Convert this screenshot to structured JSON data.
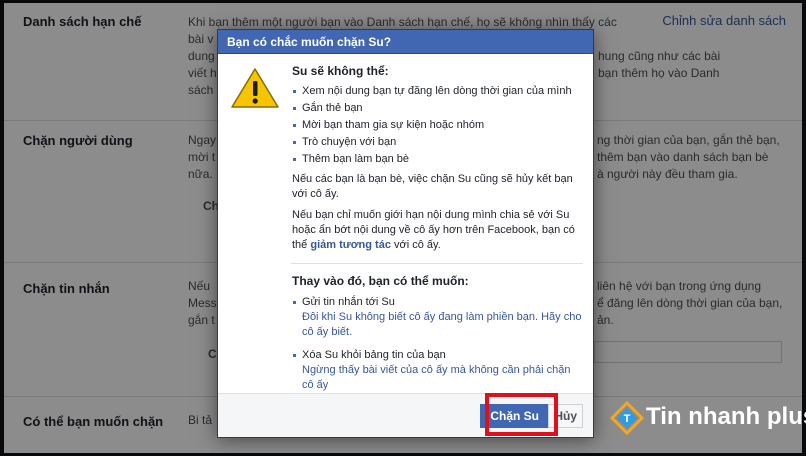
{
  "background": {
    "sections": [
      {
        "title": "Danh sách hạn chế",
        "action": "Chỉnh sửa danh sách",
        "lines": [
          "Khi bạn thêm một người bạn vào Danh sách hạn chế, họ sẽ không nhìn thấy các",
          "bài v",
          "dung",
          "viết h",
          "sách"
        ],
        "right_lines": [
          "",
          "",
          "hung cũng như các bài",
          "bạn thêm họ vào Danh",
          ""
        ]
      },
      {
        "title": "Chặn người dùng",
        "lines": [
          "Ngay",
          "mời t",
          "nữa."
        ],
        "right_lines": [
          "ng thời gian của bạn, gắn thẻ bạn,",
          "thêm bạn vào danh sách bạn bè",
          "à người này đều tham gia."
        ],
        "input_label": "Ch"
      },
      {
        "title": "Chặn tin nhắn",
        "lines": [
          "Nếu",
          "Mess",
          "gắn t"
        ],
        "right_lines": [
          "liên hệ với bạn trong ứng dụng",
          "ể đăng lên dòng thời gian của bạn,",
          "ản."
        ],
        "input_label": "C"
      },
      {
        "title": "Có thể bạn muốn chặn",
        "lines": [
          "Bi tả"
        ]
      }
    ]
  },
  "dialog": {
    "title": "Bạn có chắc muốn chặn Su?",
    "heading": "Su sẽ không thể:",
    "bullets": [
      "Xem nội dung bạn tự đăng lên dòng thời gian của mình",
      "Gắn thẻ bạn",
      "Mời bạn tham gia sự kiện hoặc nhóm",
      "Trò chuyện với bạn",
      "Thêm bạn làm bạn bè"
    ],
    "para1": "Nếu các bạn là bạn bè, việc chặn Su cũng sẽ hủy kết bạn với cô ấy.",
    "para2_prefix": "Nếu bạn chỉ muốn giới hạn nội dung mình chia sẻ với Su hoặc ẩn bớt nội dung về cô ấy hơn trên Facebook, bạn có thể ",
    "para2_link": "giảm tương tác",
    "para2_suffix": " với cô ấy.",
    "alt_heading": "Thay vào đó, bạn có thể muốn:",
    "alternatives": [
      {
        "title": "Gửi tin nhắn tới Su",
        "desc": "Đôi khi Su không biết cô ấy đang làm phiền bạn. Hãy cho cô ấy biết."
      },
      {
        "title": "Xóa Su khỏi bảng tin của bạn",
        "desc": "Ngừng thấy bài viết của cô ấy mà không cần phải chặn cô ấy"
      }
    ],
    "confirm_label": "Chặn Su",
    "cancel_label": "Hủy"
  },
  "watermark": {
    "brand": "Tin nhanh plus"
  },
  "colors": {
    "header_blue": "#4267b2",
    "link_blue": "#365899",
    "highlight_red": "#e0101a",
    "warning_yellow": "#f7c500"
  },
  "icons": {
    "warning": "warning-triangle-icon",
    "logo": "tin-nhanh-plus-logo-icon"
  }
}
